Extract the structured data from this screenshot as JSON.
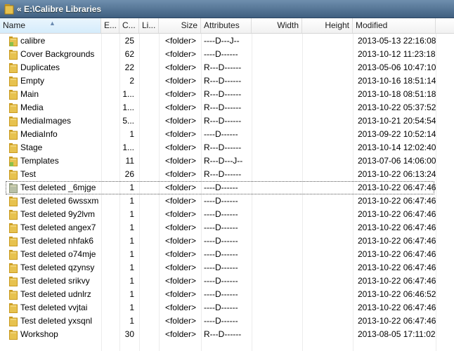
{
  "window": {
    "title": "« E:\\Calibre Libraries"
  },
  "columns": [
    {
      "key": "name",
      "label": "Name"
    },
    {
      "key": "ext",
      "label": "E..."
    },
    {
      "key": "count",
      "label": "C..."
    },
    {
      "key": "links",
      "label": "Li..."
    },
    {
      "key": "size",
      "label": "Size"
    },
    {
      "key": "attributes",
      "label": "Attributes"
    },
    {
      "key": "width",
      "label": "Width"
    },
    {
      "key": "height",
      "label": "Height"
    },
    {
      "key": "modified",
      "label": "Modified"
    }
  ],
  "colors": {
    "folder": "#e7c24f",
    "folder_dark": "#c9991d",
    "folder_green": "#8cc04a",
    "folder_grey": "#b8c0a6"
  },
  "rows": [
    {
      "name": "calibre",
      "count": "25",
      "size": "<folder>",
      "attributes": "----D---J--",
      "modified": "2013-05-13 22:16:08",
      "icon": "special-folder-icon"
    },
    {
      "name": "Cover Backgrounds",
      "count": "62",
      "size": "<folder>",
      "attributes": "----D------",
      "modified": "2013-10-12 11:23:18",
      "icon": "folder-icon"
    },
    {
      "name": "Duplicates",
      "count": "22",
      "size": "<folder>",
      "attributes": "R---D------",
      "modified": "2013-05-06 10:47:10",
      "icon": "folder-icon"
    },
    {
      "name": "Empty",
      "count": "2",
      "size": "<folder>",
      "attributes": "R---D------",
      "modified": "2013-10-16 18:51:14",
      "icon": "folder-icon"
    },
    {
      "name": "Main",
      "count": "1...",
      "size": "<folder>",
      "attributes": "R---D------",
      "modified": "2013-10-18 08:51:18",
      "icon": "folder-icon"
    },
    {
      "name": "Media",
      "count": "1...",
      "size": "<folder>",
      "attributes": "R---D------",
      "modified": "2013-10-22 05:37:52",
      "icon": "folder-icon"
    },
    {
      "name": "MediaImages",
      "count": "5...",
      "size": "<folder>",
      "attributes": "R---D------",
      "modified": "2013-10-21 20:54:54",
      "icon": "folder-icon"
    },
    {
      "name": "MediaInfo",
      "count": "1",
      "size": "<folder>",
      "attributes": "----D------",
      "modified": "2013-09-22 10:52:14",
      "icon": "folder-icon"
    },
    {
      "name": "Stage",
      "count": "1...",
      "size": "<folder>",
      "attributes": "R---D------",
      "modified": "2013-10-14 12:02:40",
      "icon": "folder-icon"
    },
    {
      "name": "Templates",
      "count": "11",
      "size": "<folder>",
      "attributes": "R---D---J--",
      "modified": "2013-07-06 14:06:00",
      "icon": "special-folder-icon"
    },
    {
      "name": "Test",
      "count": "26",
      "size": "<folder>",
      "attributes": "R---D------",
      "modified": "2013-10-22 06:13:24",
      "icon": "folder-icon"
    },
    {
      "name": "Test deleted _6mjge",
      "count": "1",
      "size": "<folder>",
      "attributes": "----D------",
      "modified": "2013-10-22 06:47:46",
      "icon": "grey-folder-icon",
      "focused": true
    },
    {
      "name": "Test deleted 6wssxm",
      "count": "1",
      "size": "<folder>",
      "attributes": "----D------",
      "modified": "2013-10-22 06:47:46",
      "icon": "folder-icon"
    },
    {
      "name": "Test deleted 9y2lvm",
      "count": "1",
      "size": "<folder>",
      "attributes": "----D------",
      "modified": "2013-10-22 06:47:46",
      "icon": "folder-icon"
    },
    {
      "name": "Test deleted angex7",
      "count": "1",
      "size": "<folder>",
      "attributes": "----D------",
      "modified": "2013-10-22 06:47:46",
      "icon": "folder-icon"
    },
    {
      "name": "Test deleted nhfak6",
      "count": "1",
      "size": "<folder>",
      "attributes": "----D------",
      "modified": "2013-10-22 06:47:46",
      "icon": "folder-icon"
    },
    {
      "name": "Test deleted o74mje",
      "count": "1",
      "size": "<folder>",
      "attributes": "----D------",
      "modified": "2013-10-22 06:47:46",
      "icon": "folder-icon"
    },
    {
      "name": "Test deleted qzynsy",
      "count": "1",
      "size": "<folder>",
      "attributes": "----D------",
      "modified": "2013-10-22 06:47:46",
      "icon": "folder-icon"
    },
    {
      "name": "Test deleted srikvy",
      "count": "1",
      "size": "<folder>",
      "attributes": "----D------",
      "modified": "2013-10-22 06:47:46",
      "icon": "folder-icon"
    },
    {
      "name": "Test deleted udnlrz",
      "count": "1",
      "size": "<folder>",
      "attributes": "----D------",
      "modified": "2013-10-22 06:46:52",
      "icon": "folder-icon"
    },
    {
      "name": "Test deleted vvjtai",
      "count": "1",
      "size": "<folder>",
      "attributes": "----D------",
      "modified": "2013-10-22 06:47:46",
      "icon": "folder-icon"
    },
    {
      "name": "Test deleted yxsqnl",
      "count": "1",
      "size": "<folder>",
      "attributes": "----D------",
      "modified": "2013-10-22 06:47:46",
      "icon": "folder-icon"
    },
    {
      "name": "Workshop",
      "count": "30",
      "size": "<folder>",
      "attributes": "R---D------",
      "modified": "2013-08-05 17:11:02",
      "icon": "folder-icon"
    }
  ]
}
